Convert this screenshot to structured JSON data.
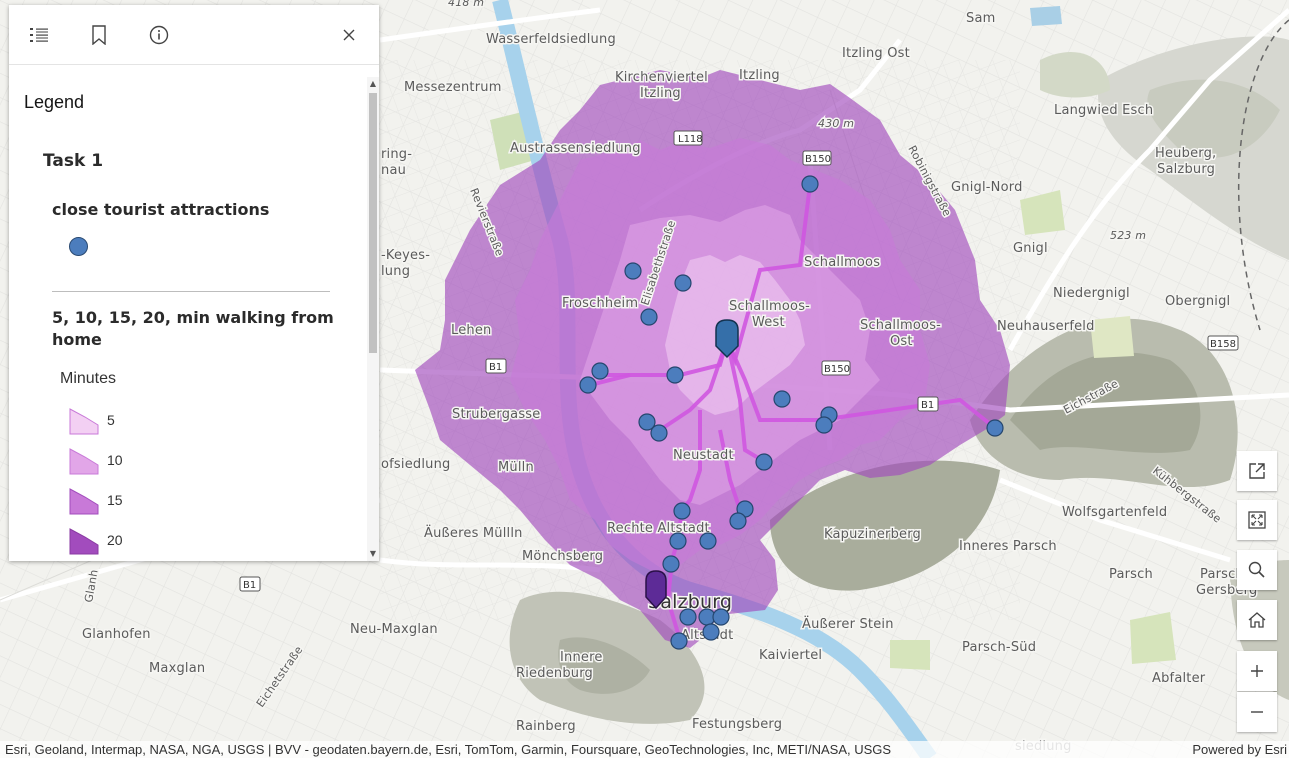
{
  "panel": {
    "tools": [
      {
        "name": "legend-tool",
        "icon": "list-icon"
      },
      {
        "name": "bookmarks-tool",
        "icon": "bookmark-icon"
      },
      {
        "name": "about-tool",
        "icon": "info-icon"
      }
    ],
    "close_icon": "close-icon",
    "legend_title": "Legend",
    "layer1_title": "Task 1",
    "layer2_title": "close tourist attractions",
    "layer3_title": "5, 10, 15, 20, min walking from home",
    "field_title": "Minutes",
    "classes": [
      {
        "label": "5",
        "color": "#f3d0f3"
      },
      {
        "label": "10",
        "color": "#e2a6e8"
      },
      {
        "label": "15",
        "color": "#c879d8"
      },
      {
        "label": "20",
        "color": "#a24cbd"
      }
    ],
    "poi_color": "#4c7dbd"
  },
  "map": {
    "labels": {
      "sam": "Sam",
      "wasserfeld": "Wasserfeldsiedlung",
      "itzling_ost": "Itzling Ost",
      "itzling": "Itzling",
      "kirchenviertel1": "Kirchenviertel",
      "kirchenviertel2": "Itzling",
      "messezentrum": "Messezentrum",
      "langwied": "Langwied Esch",
      "austrassen": "Austrassensiedlung",
      "heuberg1": "Heuberg,",
      "heuberg2": "Salzburg",
      "gnigl_nord": "Gnigl-Nord",
      "gnigl": "Gnigl",
      "ring1": "ring-",
      "ring2": "nau",
      "keyes1": "-Keyes-",
      "keyes2": "lung",
      "schallmoos": "Schallmoos",
      "niedergnigl": "Niedergnigl",
      "obergnigl": "Obergnigl",
      "froschheim": "Froschheim",
      "schallmoos_west1": "Schallmoos-",
      "schallmoos_west2": "West",
      "schallmoos_ost1": "Schallmoos-",
      "schallmoos_ost2": "Ost",
      "lehen": "Lehen",
      "neuhauserfeld": "Neuhauserfeld",
      "strubergasse": "Strubergasse",
      "neustadt": "Neustadt",
      "ofsiedlung": "ofsiedlung",
      "muelln": "Mülln",
      "wolfsgartenfeld": "Wolfsgartenfeld",
      "rechte_altstadt": "Rechte Altstadt",
      "aeusseres_muelln": "Äußeres Müllln",
      "kapuzinerberg": "Kapuzinerberg",
      "inneres_parsch": "Inneres Parsch",
      "moenchsberg": "Mönchsberg",
      "parsch": "Parsch",
      "parsch_g1": "Parsch",
      "parsch_g2": "Gersberg",
      "salzburg": "Salzburg",
      "glanhofen": "Glanhofen",
      "neu_maxglan": "Neu-Maxglan",
      "aeusserer_stein": "Äußerer Stein",
      "parsch_sued": "Parsch-Süd",
      "altstadt": "Altstadt",
      "maxglan": "Maxglan",
      "innere1": "Innere",
      "innere2": "Riedenburg",
      "kaiviertel": "Kaiviertel",
      "abfalter": "Abfalter",
      "rainberg": "Rainberg",
      "festungsberg": "Festungsberg",
      "elev_430": "430 m",
      "elev_523": "523 m",
      "elev_418": "418 m",
      "eichstrasse": "Eichstraße",
      "kuehberg": "Kühbergstraße",
      "robinig": "Robinigstraße",
      "elisabeth": "Elisabethstraße",
      "revier": "Revierstraße",
      "glanh": "Glanh",
      "eichet": "Eichetstraße",
      "siedlung": "siedlung"
    },
    "shields": {
      "l118": "L118",
      "b150a": "B150",
      "b150b": "B150",
      "b1a": "B1",
      "b1b": "B1",
      "b1c": "B1",
      "b158": "B158"
    }
  },
  "map_tools": [
    {
      "name": "open-external-button",
      "icon": "external-link-icon"
    },
    {
      "name": "fullscreen-button",
      "icon": "fullscreen-icon"
    },
    {
      "name": "search-button",
      "icon": "search-icon"
    },
    {
      "name": "home-button",
      "icon": "home-icon"
    },
    {
      "name": "zoom-in-button",
      "icon": "plus-icon"
    },
    {
      "name": "zoom-out-button",
      "icon": "minus-icon"
    }
  ],
  "attribution": "Esri, Geoland, Intermap, NASA, NGA, USGS | BVV - geodaten.bayern.de, Esri, TomTom, Garmin, Foursquare, GeoTechnologies, Inc, METI/NASA, USGS",
  "powered_by": "Powered by Esri"
}
